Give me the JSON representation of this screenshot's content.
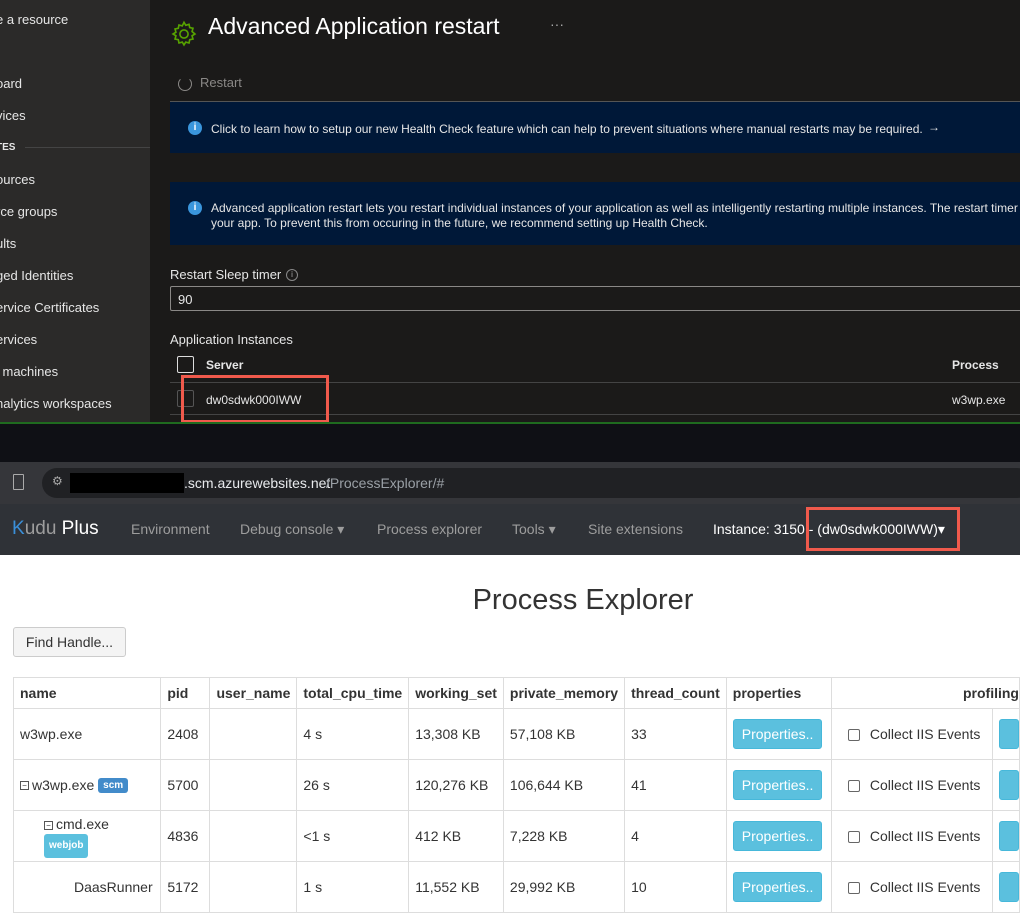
{
  "azure": {
    "sidebar": {
      "items": [
        "e a resource",
        "oard",
        "vices",
        "TES",
        "ources",
        "rce groups",
        "ults",
        "ged Identities",
        "ervice Certificates",
        "ervices",
        "l machines",
        "nalytics workspaces"
      ]
    },
    "title": "Advanced Application restart",
    "more": "···",
    "restart_label": "Restart",
    "health_banner": "Click to learn how to setup our new Health Check feature which can help to prevent situations where manual restarts may be required.",
    "health_arrow": "→",
    "info_line1": "Advanced application restart lets you restart individual instances of your application as well as intelligently restarting multiple instances. The restart timer",
    "info_line2": "your app.  To prevent this from occuring in the future, we recommend setting up Health Check.",
    "sleep_label": "Restart Sleep timer",
    "sleep_value": "90",
    "instances_label": "Application Instances",
    "col_server": "Server",
    "col_process": "Process",
    "rows": [
      {
        "server": "dw0sdwk000IWW",
        "process": "w3wp.exe"
      }
    ]
  },
  "browser": {
    "url_host": ".scm.azurewebsites.net",
    "url_path": "/ProcessExplorer/#"
  },
  "kudu": {
    "brand_k": "K",
    "brand_udu": "udu",
    "brand_plus": "Plus",
    "nav": [
      "Environment",
      "Debug console ▾",
      "Process explorer",
      "Tools ▾",
      "Site extensions"
    ],
    "instance_prefix": "Instance: 3150 ",
    "instance_value": "- (dw0sdwk000IWW)▾"
  },
  "explorer": {
    "title": "Process Explorer",
    "find_handle": "Find Handle...",
    "columns": [
      "name",
      "pid",
      "user_name",
      "total_cpu_time",
      "working_set",
      "private_memory",
      "thread_count",
      "properties",
      "profiling"
    ],
    "properties_label": "Properties..",
    "collect_label": "Collect IIS Events",
    "rows": [
      {
        "name": "w3wp.exe",
        "badge": "",
        "pid": "2408",
        "user": "",
        "cpu": "4 s",
        "ws": "13,308 KB",
        "pm": "57,108 KB",
        "threads": "33"
      },
      {
        "name": "w3wp.exe",
        "badge": "scm",
        "pid": "5700",
        "user": "",
        "cpu": "26 s",
        "ws": "120,276 KB",
        "pm": "106,644 KB",
        "threads": "41"
      },
      {
        "name": "cmd.exe",
        "badge": "webjob",
        "pid": "4836",
        "user": "",
        "cpu": "<1 s",
        "ws": "412 KB",
        "pm": "7,228 KB",
        "threads": "4"
      },
      {
        "name": "DaasRunner",
        "badge": "",
        "pid": "5172",
        "user": "",
        "cpu": "1 s",
        "ws": "11,552 KB",
        "pm": "29,992 KB",
        "threads": "10"
      }
    ],
    "colors": {
      "scm_badge": "#428bca",
      "webjob_badge": "#5bc0de",
      "button": "#5bc0de",
      "highlight": "#f05a4c"
    }
  }
}
